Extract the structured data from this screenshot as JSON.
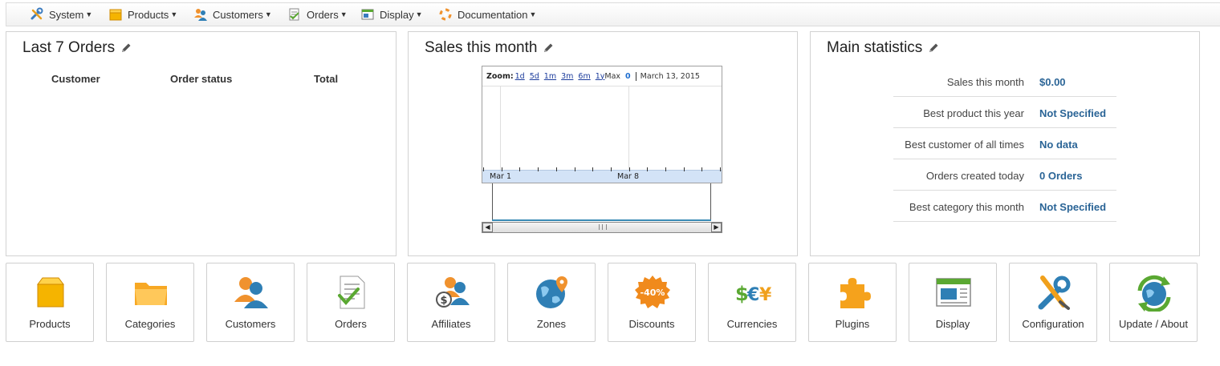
{
  "menu": [
    {
      "label": "System",
      "icon": "wrench-screwdriver-icon"
    },
    {
      "label": "Products",
      "icon": "box-icon"
    },
    {
      "label": "Customers",
      "icon": "users-icon"
    },
    {
      "label": "Orders",
      "icon": "document-icon"
    },
    {
      "label": "Display",
      "icon": "window-icon"
    },
    {
      "label": "Documentation",
      "icon": "lifebuoy-icon"
    }
  ],
  "orders_panel": {
    "title": "Last 7 Orders",
    "columns": [
      "Customer",
      "Order status",
      "Total"
    ]
  },
  "sales_panel": {
    "title": "Sales this month",
    "zoom_label": "Zoom:",
    "zoom_options": [
      "1d",
      "5d",
      "1m",
      "3m",
      "6m",
      "1y"
    ],
    "zoom_max": "Max",
    "zoom_value": "0",
    "date": "March 13, 2015",
    "axis_labels": [
      "Mar 1",
      "Mar 8"
    ]
  },
  "stats_panel": {
    "title": "Main statistics",
    "rows": [
      {
        "label": "Sales this month",
        "value": "$0.00"
      },
      {
        "label": "Best product this year",
        "value": "Not Specified"
      },
      {
        "label": "Best customer of all times",
        "value": "No data"
      },
      {
        "label": "Orders created today",
        "value": "0 Orders"
      },
      {
        "label": "Best category this month",
        "value": "Not Specified"
      }
    ]
  },
  "tiles": [
    {
      "label": "Products",
      "icon": "box-icon"
    },
    {
      "label": "Categories",
      "icon": "folder-icon"
    },
    {
      "label": "Customers",
      "icon": "users-icon"
    },
    {
      "label": "Orders",
      "icon": "document-check-icon"
    },
    {
      "label": "Affiliates",
      "icon": "affiliates-icon"
    },
    {
      "label": "Zones",
      "icon": "globe-icon"
    },
    {
      "label": "Discounts",
      "icon": "discount-badge-icon"
    },
    {
      "label": "Currencies",
      "icon": "currency-icon"
    },
    {
      "label": "Plugins",
      "icon": "puzzle-icon"
    },
    {
      "label": "Display",
      "icon": "window-icon"
    },
    {
      "label": "Configuration",
      "icon": "wrench-screwdriver-icon"
    },
    {
      "label": "Update / About",
      "icon": "refresh-globe-icon"
    }
  ],
  "colors": {
    "link": "#2a6496",
    "zoom_link": "#1c3c9c",
    "axis_strip": "#d3e3f7"
  }
}
